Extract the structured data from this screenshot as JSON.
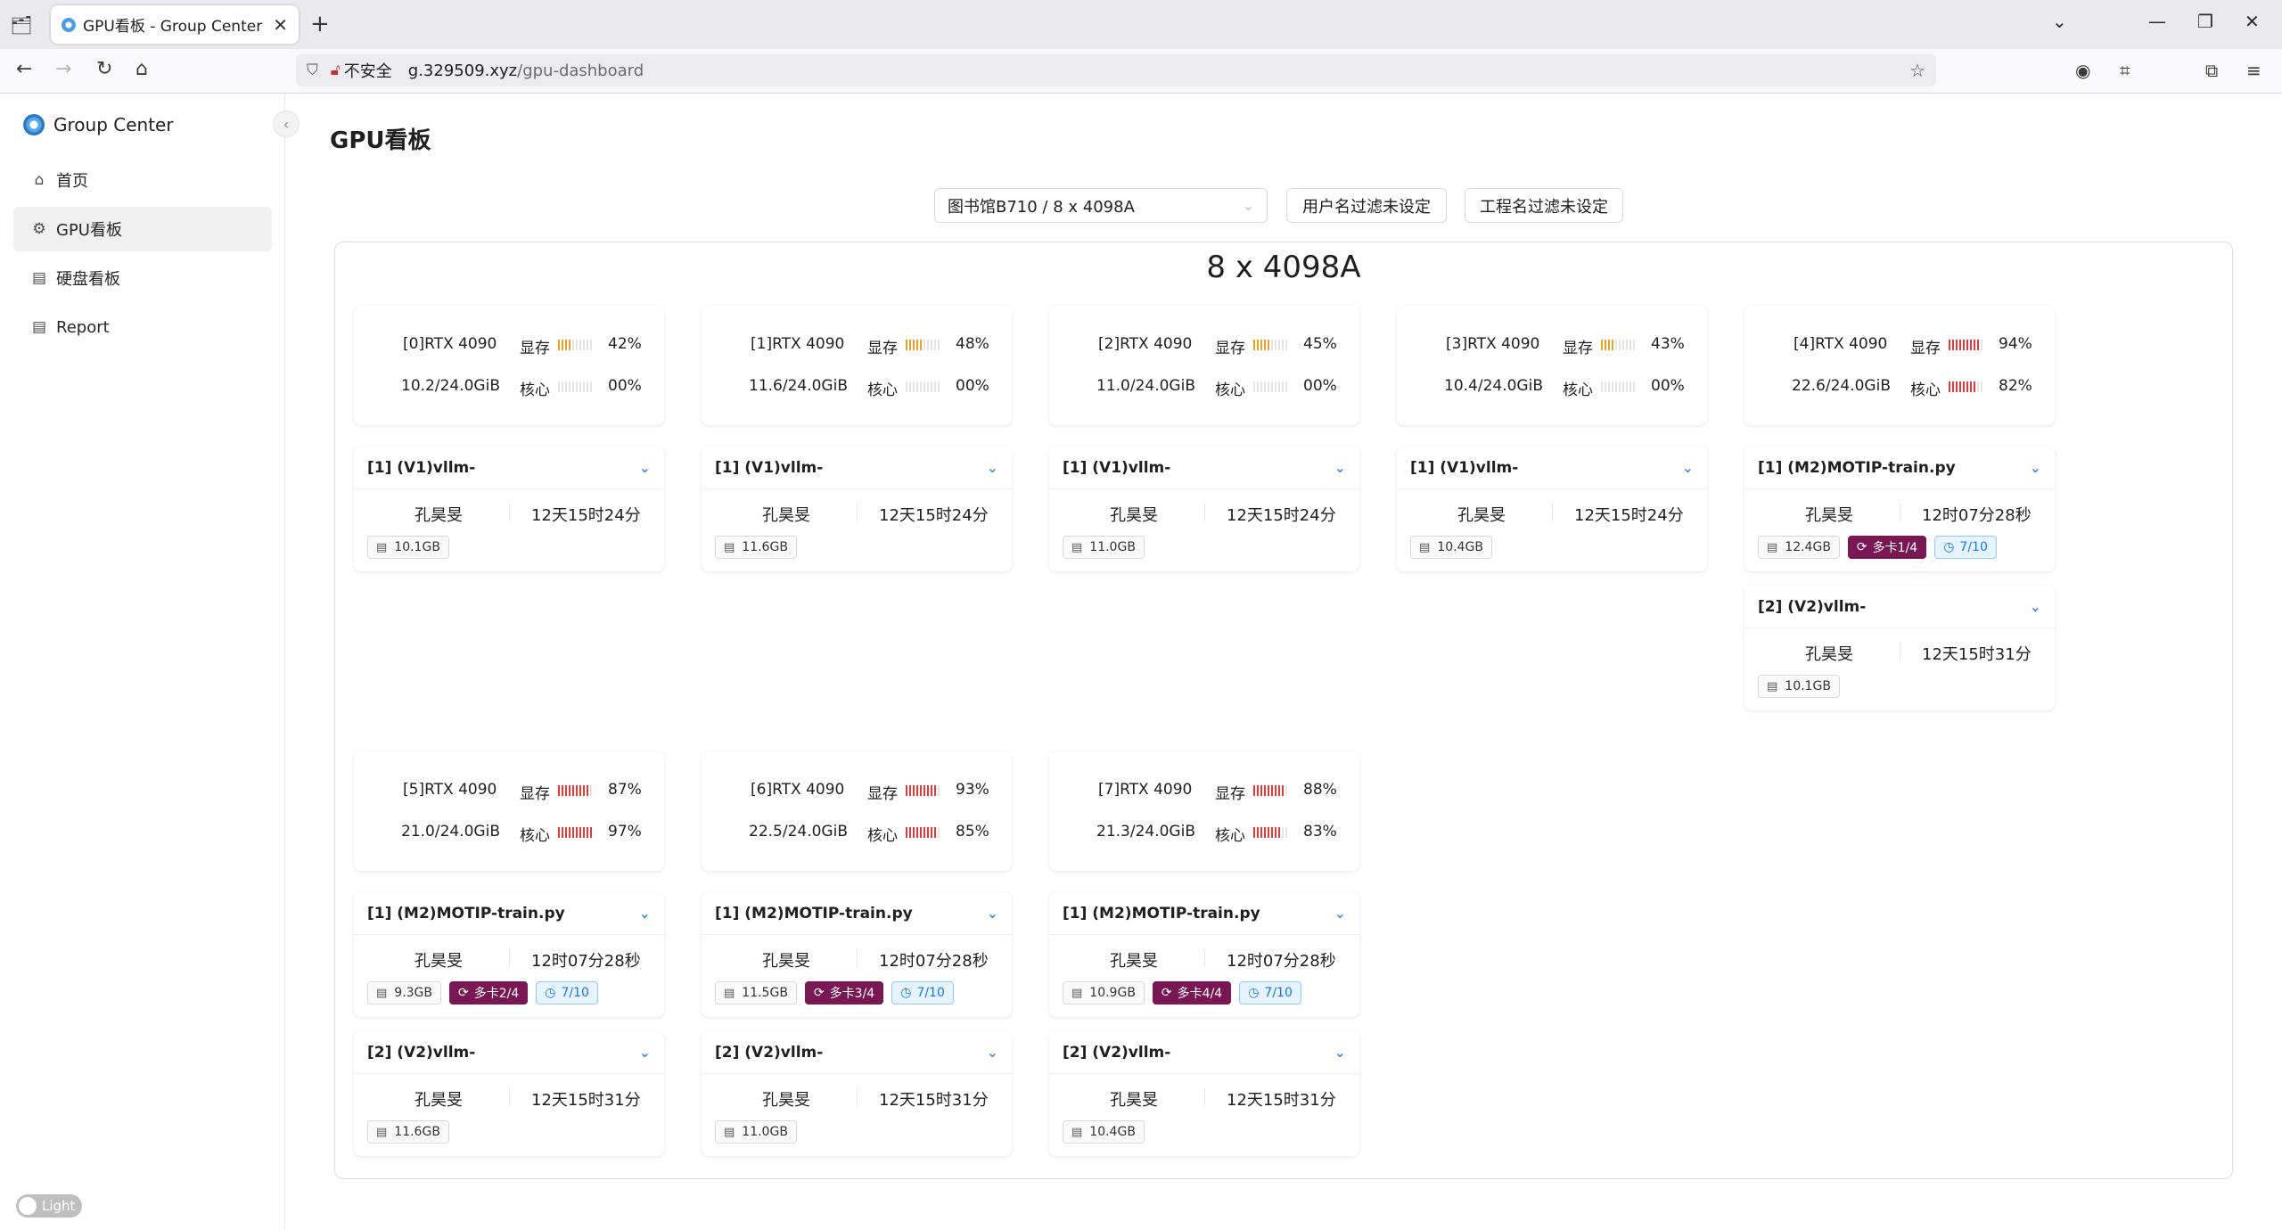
{
  "browser": {
    "tab_title": "GPU看板 - Group Center",
    "tab_close": "✕",
    "new_tab": "+",
    "url_insecure_label": "不安全",
    "url_host": "g.329509.xyz",
    "url_path": "/gpu-dashboard"
  },
  "sidebar": {
    "brand": "Group Center",
    "items": [
      {
        "label": "首页",
        "icon": "home-icon"
      },
      {
        "label": "GPU看板",
        "icon": "gpu-icon"
      },
      {
        "label": "硬盘看板",
        "icon": "disk-icon"
      },
      {
        "label": "Report",
        "icon": "report-icon"
      }
    ],
    "active_index": 1,
    "theme_label": "Light"
  },
  "page": {
    "title": "GPU看板",
    "server_select": "图书馆B710 / 8 x 4098A",
    "user_filter": "用户名过滤未设定",
    "project_filter": "工程名过滤未设定",
    "panel_title": "8 x 4098A"
  },
  "labels": {
    "vram": "显存",
    "core": "核心"
  },
  "colors": {
    "bar_empty": "#e6e6e6",
    "bar_mid": "#f0a020",
    "bar_high": "#e5383b",
    "multi_tag": "#7a1753",
    "time_tag": "#1677ff"
  },
  "gpus": [
    {
      "name": "[0]RTX 4090",
      "mem": "10.2/24.0GiB",
      "mem_pct": "42%",
      "core_pct": "00%",
      "mem_level": 0.42,
      "core_level": 0.0,
      "processes": [
        {
          "name": "[1] (V1)vllm-",
          "user": "孔昊旻",
          "time": "12天15时24分",
          "mem": "10.1GB"
        }
      ]
    },
    {
      "name": "[1]RTX 4090",
      "mem": "11.6/24.0GiB",
      "mem_pct": "48%",
      "core_pct": "00%",
      "mem_level": 0.48,
      "core_level": 0.0,
      "processes": [
        {
          "name": "[1] (V1)vllm-",
          "user": "孔昊旻",
          "time": "12天15时24分",
          "mem": "11.6GB"
        }
      ]
    },
    {
      "name": "[2]RTX 4090",
      "mem": "11.0/24.0GiB",
      "mem_pct": "45%",
      "core_pct": "00%",
      "mem_level": 0.45,
      "core_level": 0.0,
      "processes": [
        {
          "name": "[1] (V1)vllm-",
          "user": "孔昊旻",
          "time": "12天15时24分",
          "mem": "11.0GB"
        }
      ]
    },
    {
      "name": "[3]RTX 4090",
      "mem": "10.4/24.0GiB",
      "mem_pct": "43%",
      "core_pct": "00%",
      "mem_level": 0.43,
      "core_level": 0.0,
      "processes": [
        {
          "name": "[1] (V1)vllm-",
          "user": "孔昊旻",
          "time": "12天15时24分",
          "mem": "10.4GB"
        }
      ]
    },
    {
      "name": "[4]RTX 4090",
      "mem": "22.6/24.0GiB",
      "mem_pct": "94%",
      "core_pct": "82%",
      "mem_level": 0.94,
      "core_level": 0.82,
      "processes": [
        {
          "name": "[1] (M2)MOTIP-train.py",
          "user": "孔昊旻",
          "time": "12时07分28秒",
          "mem": "12.4GB",
          "multi": "多卡1/4",
          "run": "7/10"
        },
        {
          "name": "[2] (V2)vllm-",
          "user": "孔昊旻",
          "time": "12天15时31分",
          "mem": "10.1GB"
        }
      ]
    },
    {
      "name": "[5]RTX 4090",
      "mem": "21.0/24.0GiB",
      "mem_pct": "87%",
      "core_pct": "97%",
      "mem_level": 0.87,
      "core_level": 0.97,
      "processes": [
        {
          "name": "[1] (M2)MOTIP-train.py",
          "user": "孔昊旻",
          "time": "12时07分28秒",
          "mem": "9.3GB",
          "multi": "多卡2/4",
          "run": "7/10"
        },
        {
          "name": "[2] (V2)vllm-",
          "user": "孔昊旻",
          "time": "12天15时31分",
          "mem": "11.6GB"
        }
      ]
    },
    {
      "name": "[6]RTX 4090",
      "mem": "22.5/24.0GiB",
      "mem_pct": "93%",
      "core_pct": "85%",
      "mem_level": 0.93,
      "core_level": 0.85,
      "processes": [
        {
          "name": "[1] (M2)MOTIP-train.py",
          "user": "孔昊旻",
          "time": "12时07分28秒",
          "mem": "11.5GB",
          "multi": "多卡3/4",
          "run": "7/10"
        },
        {
          "name": "[2] (V2)vllm-",
          "user": "孔昊旻",
          "time": "12天15时31分",
          "mem": "11.0GB"
        }
      ]
    },
    {
      "name": "[7]RTX 4090",
      "mem": "21.3/24.0GiB",
      "mem_pct": "88%",
      "core_pct": "83%",
      "mem_level": 0.88,
      "core_level": 0.83,
      "processes": [
        {
          "name": "[1] (M2)MOTIP-train.py",
          "user": "孔昊旻",
          "time": "12时07分28秒",
          "mem": "10.9GB",
          "multi": "多卡4/4",
          "run": "7/10"
        },
        {
          "name": "[2] (V2)vllm-",
          "user": "孔昊旻",
          "time": "12天15时31分",
          "mem": "10.4GB"
        }
      ]
    }
  ]
}
